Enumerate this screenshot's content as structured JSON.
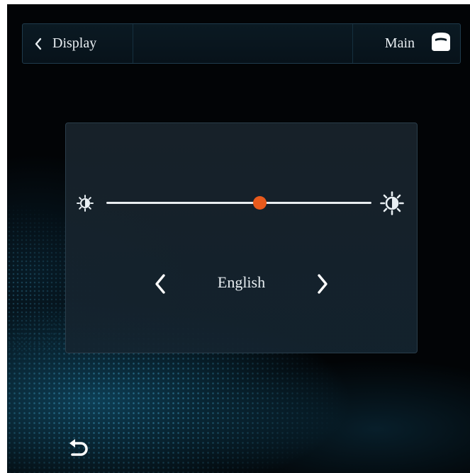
{
  "header": {
    "back_label": "Display",
    "main_label": "Main"
  },
  "brightness": {
    "level": 0.58
  },
  "language": {
    "current": "English"
  },
  "colors": {
    "accent": "#e85a1c",
    "text": "#e8eef2",
    "panel_border": "#2a3d4a"
  },
  "icons": [
    "chevron-left-icon",
    "home-icon",
    "brightness-low-icon",
    "brightness-high-icon",
    "chevron-left-icon",
    "chevron-right-icon",
    "return-icon"
  ]
}
